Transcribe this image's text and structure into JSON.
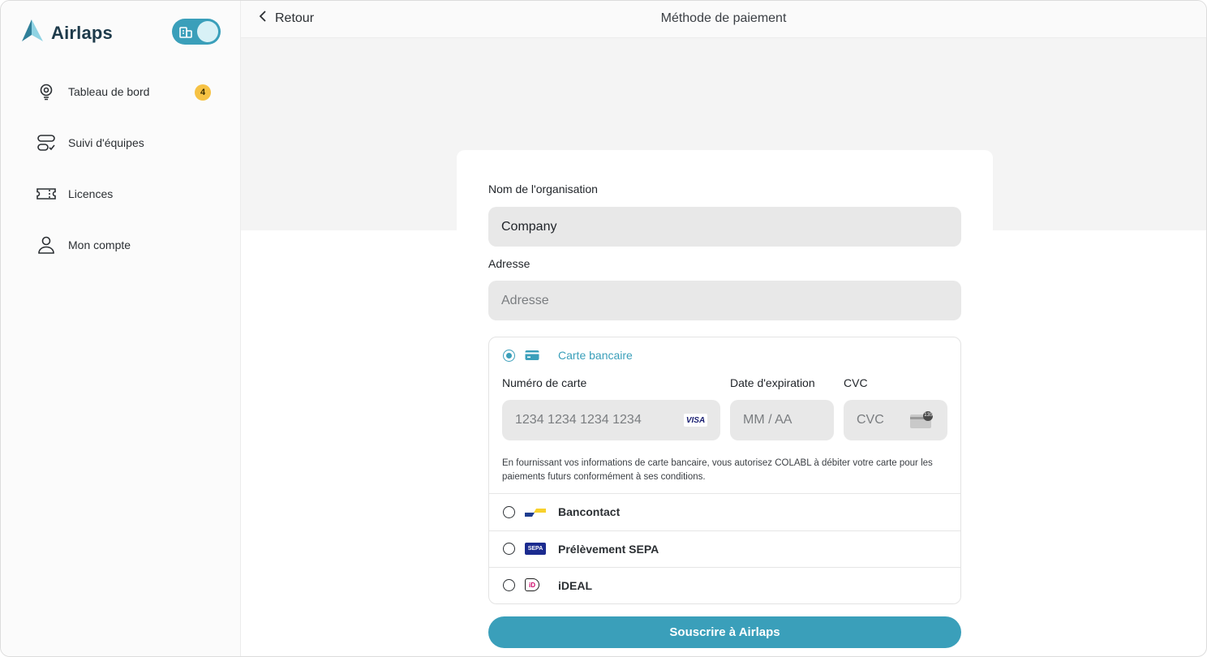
{
  "app": {
    "name": "Airlaps",
    "colors": {
      "accent": "#3a9fba",
      "badge": "#f6c244"
    }
  },
  "sidebar": {
    "toggle": {
      "state": "on",
      "icon": "building-icon"
    },
    "items": [
      {
        "label": "Tableau de bord",
        "icon": "lightbulb-icon",
        "badge": "4"
      },
      {
        "label": "Suivi d'équipes",
        "icon": "team-tracking-icon"
      },
      {
        "label": "Licences",
        "icon": "ticket-icon"
      },
      {
        "label": "Mon compte",
        "icon": "user-icon"
      }
    ]
  },
  "header": {
    "back_label": "Retour",
    "title": "Méthode de paiement"
  },
  "form": {
    "org_label": "Nom de l'organisation",
    "org_value": "Company",
    "address_label": "Adresse",
    "address_placeholder": "Adresse",
    "payment": {
      "card": {
        "label": "Carte bancaire",
        "selected": true,
        "number_label": "Numéro de carte",
        "number_placeholder": "1234 1234 1234 1234",
        "number_brand": "VISA",
        "expiry_label": "Date d'expiration",
        "expiry_placeholder": "MM / AA",
        "cvc_label": "CVC",
        "cvc_placeholder": "CVC",
        "cvc_icon_text": "135",
        "note": "En fournissant vos informations de carte bancaire, vous autorisez COLABL à débiter votre carte pour les paiements futurs conformément à ses conditions."
      },
      "options": [
        {
          "label": "Bancontact",
          "icon": "bancontact-icon",
          "selected": false
        },
        {
          "label": "Prélèvement SEPA",
          "icon": "sepa-icon",
          "icon_text": "SEPA",
          "selected": false
        },
        {
          "label": "iDEAL",
          "icon": "ideal-icon",
          "icon_text": "iD",
          "selected": false
        }
      ]
    },
    "submit_label": "Souscrire à Airlaps"
  }
}
